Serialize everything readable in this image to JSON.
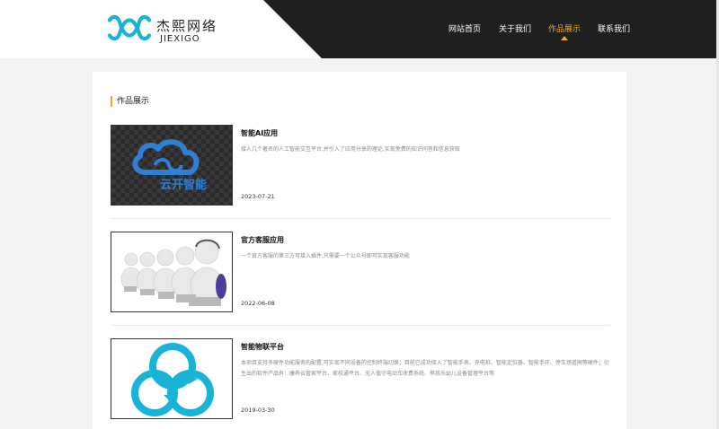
{
  "brand": {
    "name_cn": "杰熙网络",
    "name_en": "JIEXIGO",
    "logo_color": "#1ab3d8"
  },
  "nav": {
    "items": [
      {
        "label": "网站首页",
        "active": false
      },
      {
        "label": "关于我们",
        "active": false
      },
      {
        "label": "作品展示",
        "active": true
      },
      {
        "label": "联系我们",
        "active": false
      }
    ],
    "accent": "#f5a623"
  },
  "section": {
    "title": "作品展示"
  },
  "works": [
    {
      "title": "智能AI应用",
      "description": "接入几个著名的人工智能交互平台,并引入了应用分享的理论,实现免费的知识问答和信息获取",
      "date": "2023-07-21",
      "thumb_text": "云开智能",
      "thumb_icon": "cloud-logo-icon"
    },
    {
      "title": "官方客服应用",
      "description": "一个官方客服的第三方可接入插件,只需要一个公众号即可实现客服功能",
      "date": "2022-06-08",
      "thumb_icon": "customer-service-figures-icon"
    },
    {
      "title": "智能物联平台",
      "description": "本项目支持多硬件功能服务的配置,可实现不同设备的控制终端切换；目前已成功接入了智能手表、充电桩、智能定位器、智能手环、停车场道闸等硬件；衍生出的软件产品有：康养云管家平台、家校通平台、无人值守电动车收费系统、熊孩乐幼儿设备管理平台等",
      "date": "2019-03-30",
      "thumb_icon": "sync-circles-icon"
    }
  ]
}
